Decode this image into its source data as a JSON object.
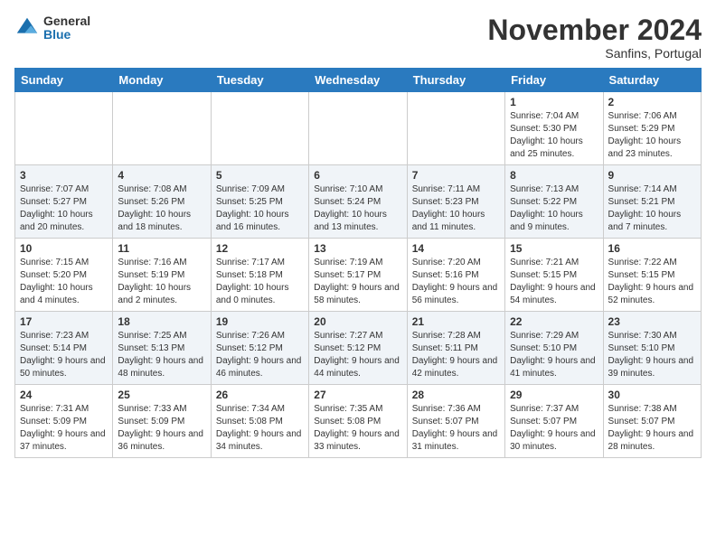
{
  "logo": {
    "general": "General",
    "blue": "Blue"
  },
  "header": {
    "month": "November 2024",
    "location": "Sanfins, Portugal"
  },
  "days_of_week": [
    "Sunday",
    "Monday",
    "Tuesday",
    "Wednesday",
    "Thursday",
    "Friday",
    "Saturday"
  ],
  "weeks": [
    [
      {
        "day": "",
        "info": ""
      },
      {
        "day": "",
        "info": ""
      },
      {
        "day": "",
        "info": ""
      },
      {
        "day": "",
        "info": ""
      },
      {
        "day": "",
        "info": ""
      },
      {
        "day": "1",
        "info": "Sunrise: 7:04 AM\nSunset: 5:30 PM\nDaylight: 10 hours and 25 minutes."
      },
      {
        "day": "2",
        "info": "Sunrise: 7:06 AM\nSunset: 5:29 PM\nDaylight: 10 hours and 23 minutes."
      }
    ],
    [
      {
        "day": "3",
        "info": "Sunrise: 7:07 AM\nSunset: 5:27 PM\nDaylight: 10 hours and 20 minutes."
      },
      {
        "day": "4",
        "info": "Sunrise: 7:08 AM\nSunset: 5:26 PM\nDaylight: 10 hours and 18 minutes."
      },
      {
        "day": "5",
        "info": "Sunrise: 7:09 AM\nSunset: 5:25 PM\nDaylight: 10 hours and 16 minutes."
      },
      {
        "day": "6",
        "info": "Sunrise: 7:10 AM\nSunset: 5:24 PM\nDaylight: 10 hours and 13 minutes."
      },
      {
        "day": "7",
        "info": "Sunrise: 7:11 AM\nSunset: 5:23 PM\nDaylight: 10 hours and 11 minutes."
      },
      {
        "day": "8",
        "info": "Sunrise: 7:13 AM\nSunset: 5:22 PM\nDaylight: 10 hours and 9 minutes."
      },
      {
        "day": "9",
        "info": "Sunrise: 7:14 AM\nSunset: 5:21 PM\nDaylight: 10 hours and 7 minutes."
      }
    ],
    [
      {
        "day": "10",
        "info": "Sunrise: 7:15 AM\nSunset: 5:20 PM\nDaylight: 10 hours and 4 minutes."
      },
      {
        "day": "11",
        "info": "Sunrise: 7:16 AM\nSunset: 5:19 PM\nDaylight: 10 hours and 2 minutes."
      },
      {
        "day": "12",
        "info": "Sunrise: 7:17 AM\nSunset: 5:18 PM\nDaylight: 10 hours and 0 minutes."
      },
      {
        "day": "13",
        "info": "Sunrise: 7:19 AM\nSunset: 5:17 PM\nDaylight: 9 hours and 58 minutes."
      },
      {
        "day": "14",
        "info": "Sunrise: 7:20 AM\nSunset: 5:16 PM\nDaylight: 9 hours and 56 minutes."
      },
      {
        "day": "15",
        "info": "Sunrise: 7:21 AM\nSunset: 5:15 PM\nDaylight: 9 hours and 54 minutes."
      },
      {
        "day": "16",
        "info": "Sunrise: 7:22 AM\nSunset: 5:15 PM\nDaylight: 9 hours and 52 minutes."
      }
    ],
    [
      {
        "day": "17",
        "info": "Sunrise: 7:23 AM\nSunset: 5:14 PM\nDaylight: 9 hours and 50 minutes."
      },
      {
        "day": "18",
        "info": "Sunrise: 7:25 AM\nSunset: 5:13 PM\nDaylight: 9 hours and 48 minutes."
      },
      {
        "day": "19",
        "info": "Sunrise: 7:26 AM\nSunset: 5:12 PM\nDaylight: 9 hours and 46 minutes."
      },
      {
        "day": "20",
        "info": "Sunrise: 7:27 AM\nSunset: 5:12 PM\nDaylight: 9 hours and 44 minutes."
      },
      {
        "day": "21",
        "info": "Sunrise: 7:28 AM\nSunset: 5:11 PM\nDaylight: 9 hours and 42 minutes."
      },
      {
        "day": "22",
        "info": "Sunrise: 7:29 AM\nSunset: 5:10 PM\nDaylight: 9 hours and 41 minutes."
      },
      {
        "day": "23",
        "info": "Sunrise: 7:30 AM\nSunset: 5:10 PM\nDaylight: 9 hours and 39 minutes."
      }
    ],
    [
      {
        "day": "24",
        "info": "Sunrise: 7:31 AM\nSunset: 5:09 PM\nDaylight: 9 hours and 37 minutes."
      },
      {
        "day": "25",
        "info": "Sunrise: 7:33 AM\nSunset: 5:09 PM\nDaylight: 9 hours and 36 minutes."
      },
      {
        "day": "26",
        "info": "Sunrise: 7:34 AM\nSunset: 5:08 PM\nDaylight: 9 hours and 34 minutes."
      },
      {
        "day": "27",
        "info": "Sunrise: 7:35 AM\nSunset: 5:08 PM\nDaylight: 9 hours and 33 minutes."
      },
      {
        "day": "28",
        "info": "Sunrise: 7:36 AM\nSunset: 5:07 PM\nDaylight: 9 hours and 31 minutes."
      },
      {
        "day": "29",
        "info": "Sunrise: 7:37 AM\nSunset: 5:07 PM\nDaylight: 9 hours and 30 minutes."
      },
      {
        "day": "30",
        "info": "Sunrise: 7:38 AM\nSunset: 5:07 PM\nDaylight: 9 hours and 28 minutes."
      }
    ]
  ]
}
